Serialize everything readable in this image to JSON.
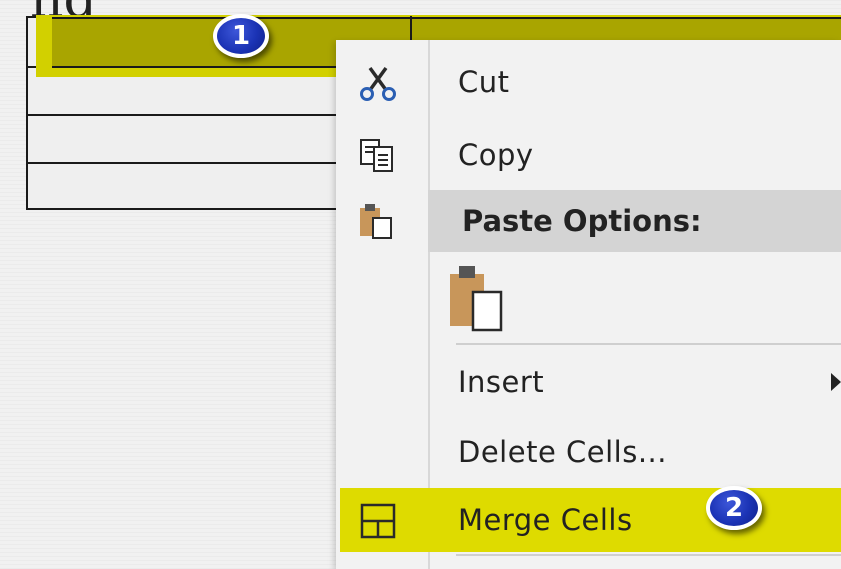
{
  "document": {
    "heading_fragment": "ng"
  },
  "callouts": {
    "first": "1",
    "second": "2"
  },
  "context_menu": {
    "cut": "Cut",
    "copy": "Copy",
    "paste_options": "Paste Options:",
    "insert": "Insert",
    "delete_cells": "Delete Cells...",
    "merge_cells": "Merge Cells"
  },
  "icons": {
    "cut": "scissors-icon",
    "copy": "copy-icon",
    "paste_options": "clipboard-icon",
    "paste_keep": "clipboard-paste-icon",
    "merge_cells": "merge-cells-icon",
    "submenu": "chevron-right-icon"
  },
  "colors": {
    "selection_highlight": "#d2d000",
    "selected_cell": "#a9a500",
    "callout_blue": "#1b33b5",
    "clipboard_tan": "#c8965a"
  }
}
